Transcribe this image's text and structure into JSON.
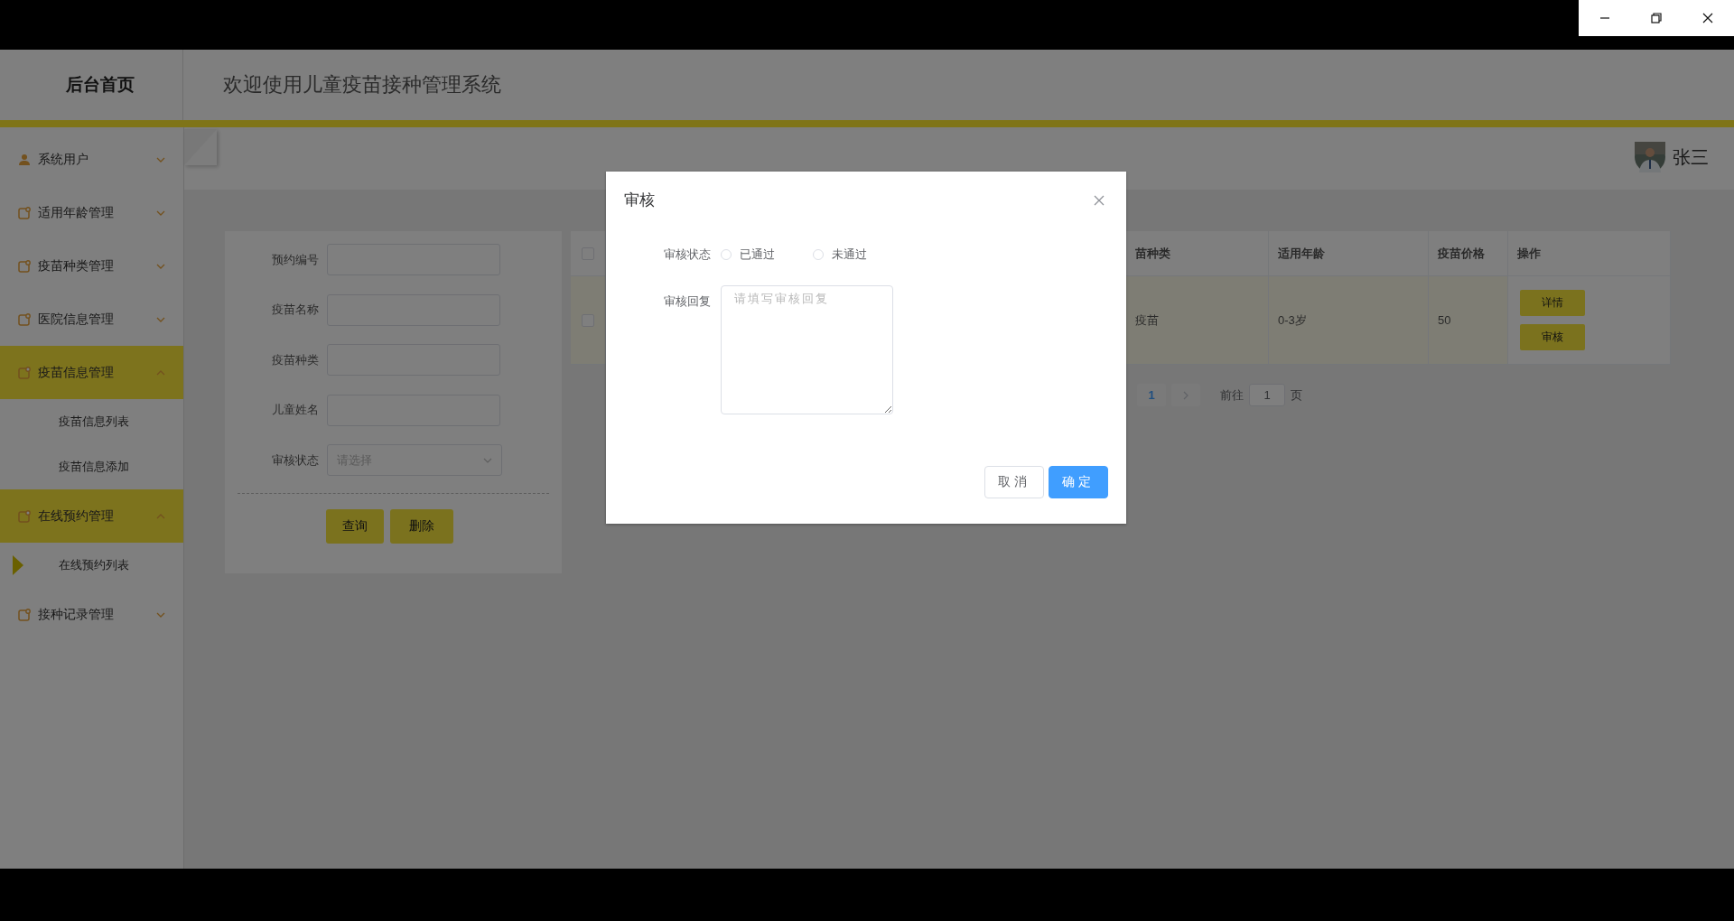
{
  "header": {
    "logo": "后台首页",
    "title": "欢迎使用儿童疫苗接种管理系统"
  },
  "user": {
    "name": "张三"
  },
  "sidebar": {
    "items": [
      {
        "label": "系统用户",
        "kind": "user",
        "expanded": false
      },
      {
        "label": "适用年龄管理",
        "kind": "folder",
        "expanded": false
      },
      {
        "label": "疫苗种类管理",
        "kind": "folder",
        "expanded": false
      },
      {
        "label": "医院信息管理",
        "kind": "folder",
        "expanded": false
      },
      {
        "label": "疫苗信息管理",
        "kind": "folder",
        "expanded": true,
        "children": [
          {
            "label": "疫苗信息列表",
            "selected": false
          },
          {
            "label": "疫苗信息添加",
            "selected": false
          }
        ]
      },
      {
        "label": "在线预约管理",
        "kind": "folder",
        "expanded": true,
        "children": [
          {
            "label": "在线预约列表",
            "selected": true
          }
        ]
      },
      {
        "label": "接种记录管理",
        "kind": "folder",
        "expanded": false
      }
    ]
  },
  "search_form": {
    "fields": [
      {
        "label": "预约编号",
        "kind": "input"
      },
      {
        "label": "疫苗名称",
        "kind": "input"
      },
      {
        "label": "疫苗种类",
        "kind": "input"
      },
      {
        "label": "儿童姓名",
        "kind": "input"
      },
      {
        "label": "审核状态",
        "kind": "select",
        "placeholder": "请选择"
      }
    ],
    "buttons": [
      "查询",
      "删除"
    ]
  },
  "table": {
    "header_checked": false,
    "columns": [
      "苗种类",
      "适用年龄",
      "疫苗价格",
      "操作"
    ],
    "rows": [
      {
        "checked": false,
        "cells": [
          "疫苗",
          "0-3岁",
          "50"
        ],
        "actions": [
          "详情",
          "审核"
        ]
      }
    ]
  },
  "pagination": {
    "pages": [
      {
        "label": "1",
        "selected": true
      }
    ],
    "goto_label": "前往",
    "goto_value": "1",
    "suffix": "页"
  },
  "dialog": {
    "title": "审核",
    "status_label": "审核状态",
    "options": [
      {
        "label": "已通过",
        "selected": false
      },
      {
        "label": "未通过",
        "selected": false
      }
    ],
    "reply_label": "审核回复",
    "reply_placeholder": "请填写审核回复",
    "buttons": [
      {
        "label": "取消",
        "kind": "default"
      },
      {
        "label": "确定",
        "kind": "primary"
      }
    ]
  }
}
